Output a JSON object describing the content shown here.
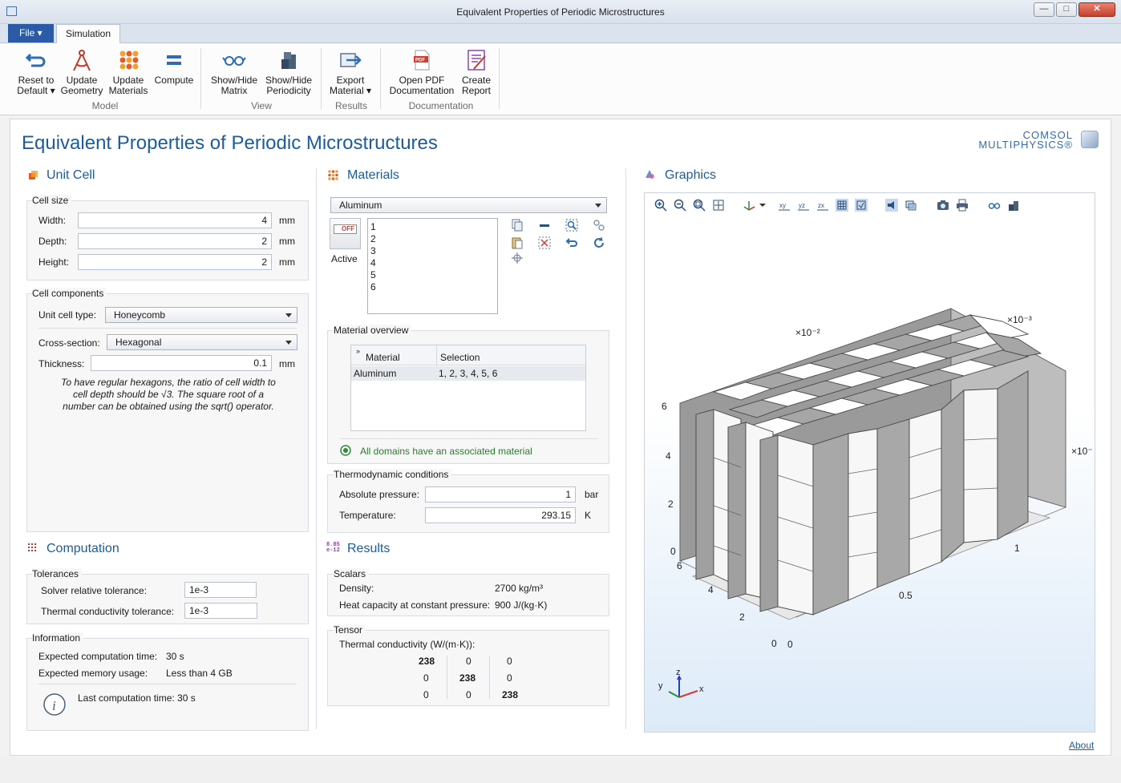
{
  "window": {
    "title": "Equivalent Properties of Periodic Microstructures"
  },
  "tabs": {
    "file": "File",
    "simulation": "Simulation"
  },
  "ribbon": {
    "reset": [
      "Reset to",
      "Default"
    ],
    "update_geometry": [
      "Update",
      "Geometry"
    ],
    "update_materials": [
      "Update",
      "Materials"
    ],
    "compute": "Compute",
    "group_model": "Model",
    "show_hide_matrix": [
      "Show/Hide",
      "Matrix"
    ],
    "show_hide_periodicity": [
      "Show/Hide",
      "Periodicity"
    ],
    "group_view": "View",
    "export_material": [
      "Export",
      "Material"
    ],
    "group_results": "Results",
    "open_pdf": [
      "Open PDF",
      "Documentation"
    ],
    "create_report": [
      "Create",
      "Report"
    ],
    "group_documentation": "Documentation"
  },
  "app": {
    "title": "Equivalent Properties of Periodic Microstructures",
    "logo_line1": "COMSOL",
    "logo_line2": "MULTIPHYSICS®",
    "about": "About"
  },
  "unit_cell": {
    "heading": "Unit Cell",
    "cell_size_title": "Cell size",
    "width_label": "Width:",
    "width_value": "4",
    "width_unit": "mm",
    "depth_label": "Depth:",
    "depth_value": "2",
    "depth_unit": "mm",
    "height_label": "Height:",
    "height_value": "2",
    "height_unit": "mm",
    "components_title": "Cell components",
    "type_label": "Unit cell type:",
    "type_value": "Honeycomb",
    "cross_label": "Cross-section:",
    "cross_value": "Hexagonal",
    "thickness_label": "Thickness:",
    "thickness_value": "0.1",
    "thickness_unit": "mm",
    "note_lines": [
      "To have regular hexagons, the ratio of cell width to",
      "cell depth should be √3. The square root of a",
      "number can be obtained using the sqrt() operator."
    ]
  },
  "computation": {
    "heading": "Computation",
    "tolerances_title": "Tolerances",
    "solver_label": "Solver relative tolerance:",
    "solver_value": "1e-3",
    "thermal_label": "Thermal conductivity tolerance:",
    "thermal_value": "1e-3",
    "info_title": "Information",
    "time_label": "Expected computation time:",
    "time_value": "30 s",
    "mem_label": "Expected memory usage:",
    "mem_value": "Less than 4 GB",
    "last_label": "Last computation time: 30 s"
  },
  "materials": {
    "heading": "Materials",
    "selected": "Aluminum",
    "active_label": "Active",
    "toggle_text": "OFF",
    "domains": [
      "1",
      "2",
      "3",
      "4",
      "5",
      "6"
    ],
    "overview_title": "Material overview",
    "col_material": "Material",
    "col_selection": "Selection",
    "row_material": "Aluminum",
    "row_selection": "1, 2, 3, 4, 5, 6",
    "status": "All domains have an associated material",
    "thermo_title": "Thermodynamic conditions",
    "pressure_label": "Absolute pressure:",
    "pressure_value": "1",
    "pressure_unit": "bar",
    "temp_label": "Temperature:",
    "temp_value": "293.15",
    "temp_unit": "K"
  },
  "results": {
    "heading": "Results",
    "icon_text_1": "8.85",
    "icon_text_2": "e-12",
    "scalars_title": "Scalars",
    "density_label": "Density:",
    "density_value": "2700 kg/m³",
    "heatcap_label": "Heat capacity at constant pressure:",
    "heatcap_value": "900 J/(kg·K)",
    "tensor_title": "Tensor",
    "tensor_label": "Thermal conductivity (W/(m·K)):",
    "tensor": [
      [
        "238",
        "0",
        "0"
      ],
      [
        "0",
        "238",
        "0"
      ],
      [
        "0",
        "0",
        "238"
      ]
    ]
  },
  "graphics": {
    "heading": "Graphics",
    "scale_x": "×10⁻²",
    "scale_y": "×10⁻³",
    "scale_z": "×10⁻",
    "z_ticks": [
      "6",
      "4",
      "2",
      "0"
    ],
    "y_ticks": [
      "6",
      "4",
      "2",
      "0"
    ],
    "x_ticks": [
      "0",
      "0.5",
      "1"
    ],
    "axis_x": "x",
    "axis_y": "y",
    "axis_z": "z"
  }
}
